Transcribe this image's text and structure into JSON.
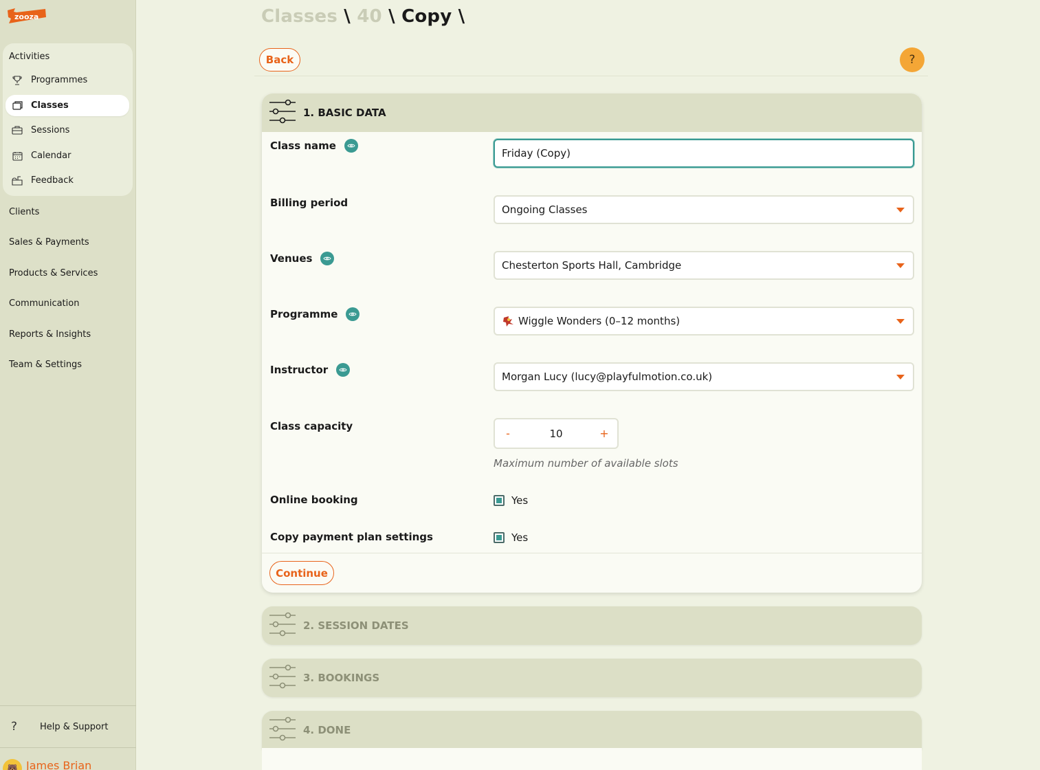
{
  "brand": {
    "logo_text": "zooza",
    "accent": "#e8631a",
    "teal": "#3a9a92"
  },
  "sidebar": {
    "activities_title": "Activities",
    "activities": [
      {
        "label": "Programmes",
        "icon": "trophy-icon",
        "active": false
      },
      {
        "label": "Classes",
        "icon": "classes-icon",
        "active": true
      },
      {
        "label": "Sessions",
        "icon": "briefcase-icon",
        "active": false
      },
      {
        "label": "Calendar",
        "icon": "calendar-icon",
        "active": false
      },
      {
        "label": "Feedback",
        "icon": "mailbox-icon",
        "active": false
      }
    ],
    "main": [
      "Clients",
      "Sales & Payments",
      "Products & Services",
      "Communication",
      "Reports & Insights",
      "Team & Settings"
    ],
    "help_label": "Help & Support",
    "user_name": "James Brian"
  },
  "breadcrumb": {
    "part1": "Classes",
    "part2": "40",
    "part3": "Copy",
    "sep": "\\"
  },
  "toolbar": {
    "back_label": "Back",
    "help_label": "?"
  },
  "form": {
    "section_title": "1. BASIC DATA",
    "class_name": {
      "label": "Class name",
      "value": "Friday (Copy)"
    },
    "billing_period": {
      "label": "Billing period",
      "value": "Ongoing Classes"
    },
    "venues": {
      "label": "Venues",
      "value": "Chesterton Sports Hall, Cambridge"
    },
    "programme": {
      "label": "Programme",
      "value": "Wiggle Wonders (0–12 months)"
    },
    "instructor": {
      "label": "Instructor",
      "value": "Morgan Lucy (lucy@playfulmotion.co.uk)"
    },
    "capacity": {
      "label": "Class capacity",
      "value": "10",
      "minus": "-",
      "plus": "+",
      "hint": "Maximum number of available slots"
    },
    "online_booking": {
      "label": "Online booking",
      "option": "Yes",
      "checked": true
    },
    "copy_payment": {
      "label": "Copy payment plan settings",
      "option": "Yes",
      "checked": true
    },
    "continue_label": "Continue"
  },
  "steps": [
    "2. SESSION DATES",
    "3. BOOKINGS",
    "4. DONE"
  ]
}
